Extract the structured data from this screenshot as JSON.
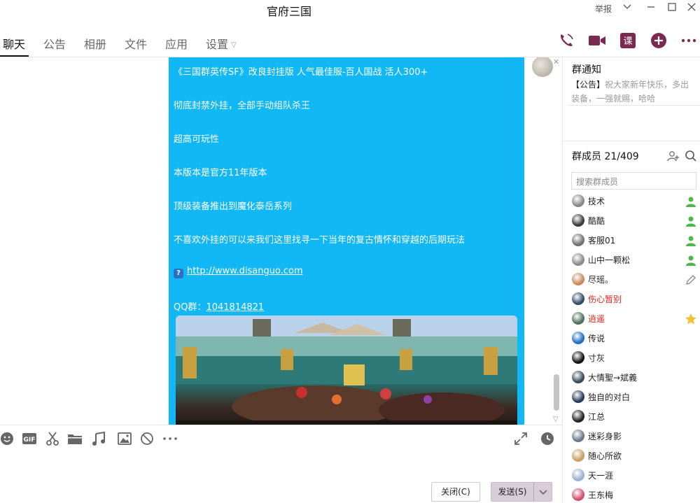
{
  "window": {
    "title": "官府三国",
    "report_label": "举报"
  },
  "tabs": [
    {
      "label": "聊天",
      "active": true
    },
    {
      "label": "公告"
    },
    {
      "label": "相册"
    },
    {
      "label": "文件"
    },
    {
      "label": "应用"
    },
    {
      "label": "设置"
    }
  ],
  "message": {
    "lines": [
      "《三国群英传SF》改良封挂版 人气最佳服-百人国战 活人300+",
      "彻底封禁外挂，全部手动组队杀王",
      "超高可玩性",
      "本版本是官方11年版本",
      "顶级装备推出到魔化泰岳系列",
      "不喜欢外挂的可以来我们这里找寻一下当年的复古情怀和穿越的后期玩法"
    ],
    "link_icon": "?",
    "link": "http://www.disanguo.com",
    "qq_label": "QQ群：",
    "qq_number": "1041814821"
  },
  "buttons": {
    "close": "关闭(C)",
    "send": "发送(S)"
  },
  "group_notice": {
    "title": "群通知",
    "tag": "【公告】",
    "text": "祝大家新年快乐，多出装备，一强就赐，哈哈"
  },
  "members": {
    "title": "群成员 21/409",
    "search_placeholder": "搜索群成员",
    "list": [
      {
        "name": "技术",
        "color": "#888888",
        "badge": "admin"
      },
      {
        "name": "酷酷",
        "color": "#3a3a3a",
        "badge": "admin"
      },
      {
        "name": "客服01",
        "color": "#707070",
        "badge": "admin"
      },
      {
        "name": "山中一颗松",
        "color": "#8a8a8a",
        "badge": "admin"
      },
      {
        "name": "尽瑶。",
        "color": "#c98a5a",
        "badge": "edit"
      },
      {
        "name": "伤心暂别",
        "color": "#2f4d6a",
        "red": true
      },
      {
        "name": "逍遥",
        "color": "#4f6f5f",
        "red": true,
        "badge": "star"
      },
      {
        "name": "传说",
        "color": "#1f6fbf"
      },
      {
        "name": "寸灰",
        "color": "#111111"
      },
      {
        "name": "大情聖→斌義",
        "color": "#3a4a5a"
      },
      {
        "name": "独自的对白",
        "color": "#2a3a5a"
      },
      {
        "name": "江总",
        "color": "#222222"
      },
      {
        "name": "迷彩身影",
        "color": "#6a7a8a"
      },
      {
        "name": "随心所欲",
        "color": "#c8a060"
      },
      {
        "name": "天一涯",
        "color": "#9ab0d0"
      },
      {
        "name": "王东梅",
        "color": "#d05070"
      }
    ]
  },
  "colors": {
    "bubble": "#12b7f5",
    "accent_icon": "#7a2a50",
    "admin_badge": "#4cb84c",
    "star_badge": "#f2c230"
  }
}
